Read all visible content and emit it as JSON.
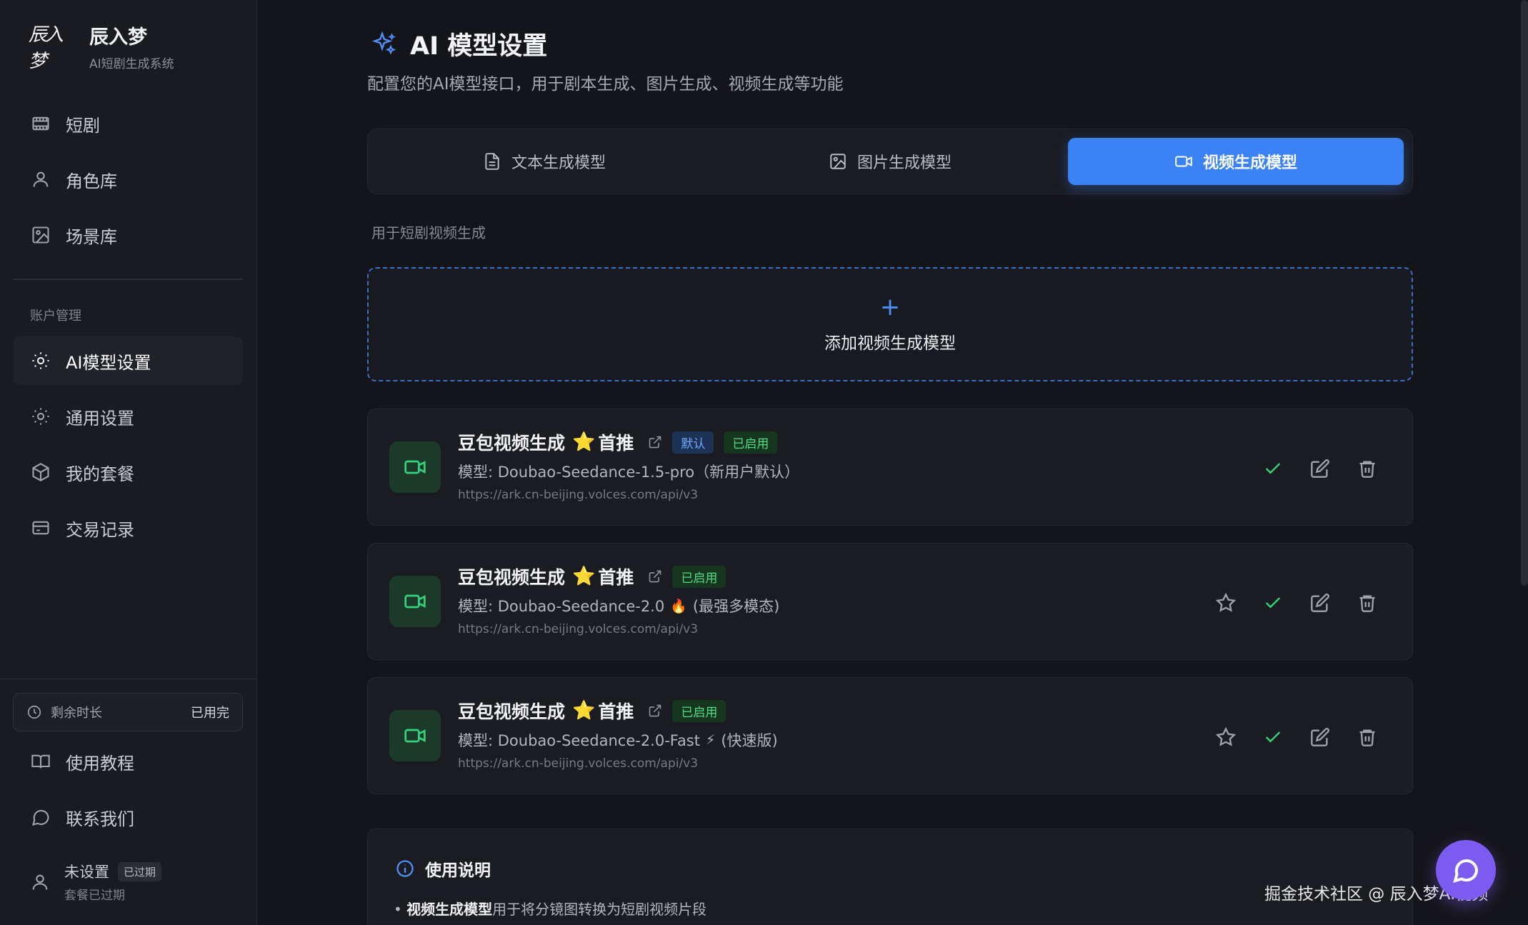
{
  "brand": {
    "logo_text": "辰入梦",
    "name": "辰入梦",
    "subtitle": "AI短剧生成系统"
  },
  "sidebar": {
    "items": [
      {
        "label": "短剧",
        "icon": "film-icon"
      },
      {
        "label": "角色库",
        "icon": "user-icon"
      },
      {
        "label": "场景库",
        "icon": "image-icon"
      }
    ],
    "section_label": "账户管理",
    "account_items": [
      {
        "label": "AI模型设置",
        "icon": "sun-icon"
      },
      {
        "label": "通用设置",
        "icon": "sun-icon"
      },
      {
        "label": "我的套餐",
        "icon": "box-icon"
      },
      {
        "label": "交易记录",
        "icon": "card-icon"
      }
    ],
    "remaining": {
      "label": "剩余时长",
      "value": "已用完"
    },
    "bottom_items": [
      {
        "label": "使用教程",
        "icon": "book-icon"
      },
      {
        "label": "联系我们",
        "icon": "chat-icon"
      }
    ],
    "user": {
      "name": "未设置",
      "badge": "已过期",
      "sub": "套餐已过期"
    }
  },
  "page": {
    "title": "AI 模型设置",
    "subtitle": "配置您的AI模型接口，用于剧本生成、图片生成、视频生成等功能"
  },
  "tabs": [
    {
      "label": "文本生成模型",
      "active": false
    },
    {
      "label": "图片生成模型",
      "active": false
    },
    {
      "label": "视频生成模型",
      "active": true
    }
  ],
  "tab_description": "用于短剧视频生成",
  "add_model": {
    "plus": "+",
    "label": "添加视频生成模型"
  },
  "models": [
    {
      "name": "豆包视频生成",
      "star": "⭐",
      "recommend": "首推",
      "badges": [
        "默认",
        "已启用"
      ],
      "model_prefix": "模型: Doubao-Seedance-1.5-pro（新用户默认）",
      "emoji": "",
      "model_suffix": "",
      "url": "https://ark.cn-beijing.volces.com/api/v3",
      "show_star_action": false
    },
    {
      "name": "豆包视频生成",
      "star": "⭐",
      "recommend": "首推",
      "badges": [
        "已启用"
      ],
      "model_prefix": "模型: Doubao-Seedance-2.0",
      "emoji": "🔥",
      "model_suffix": "(最强多模态)",
      "url": "https://ark.cn-beijing.volces.com/api/v3",
      "show_star_action": true
    },
    {
      "name": "豆包视频生成",
      "star": "⭐",
      "recommend": "首推",
      "badges": [
        "已启用"
      ],
      "model_prefix": "模型: Doubao-Seedance-2.0-Fast",
      "emoji": "⚡",
      "model_suffix": "(快速版)",
      "url": "https://ark.cn-beijing.volces.com/api/v3",
      "show_star_action": true
    }
  ],
  "usage": {
    "title": "使用说明",
    "bullet": "•",
    "bold": "视频生成模型",
    "text": "用于将分镜图转换为短剧视频片段"
  },
  "watermark": "掘金技术社区 @ 辰入梦AI视频",
  "colors": {
    "accent": "#3b82f6",
    "success": "#34d27a",
    "star": "#f5b82e",
    "fab": "#7c5cf0"
  }
}
